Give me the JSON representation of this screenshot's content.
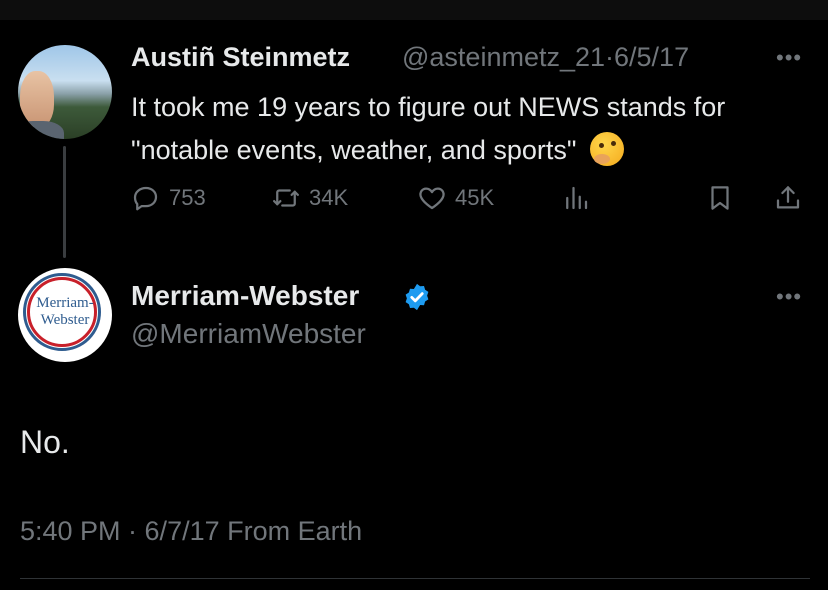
{
  "original_tweet": {
    "author_name": "Austiñ Steinmetz",
    "handle": "@asteinmetz_21",
    "separator": "·",
    "date": "6/5/17",
    "text": "It took me 19 years to figure out NEWS stands for \"notable events, weather, and sports\"",
    "emoji": "thinking-face",
    "more_label": "•••",
    "stats": {
      "replies": "753",
      "retweets": "34K",
      "likes": "45K"
    }
  },
  "reply_tweet": {
    "author_name": "Merriam-Webster",
    "handle": "@MerriamWebster",
    "verified": true,
    "avatar_logo_line1": "Merriam-",
    "avatar_logo_line2": "Webster",
    "more_label": "•••",
    "text": "No.",
    "meta": "5:40 PM · 6/7/17 From Earth"
  },
  "colors": {
    "background": "#000000",
    "text": "#e7e9ea",
    "muted": "#71767b",
    "verified_blue": "#1d9bf0"
  }
}
